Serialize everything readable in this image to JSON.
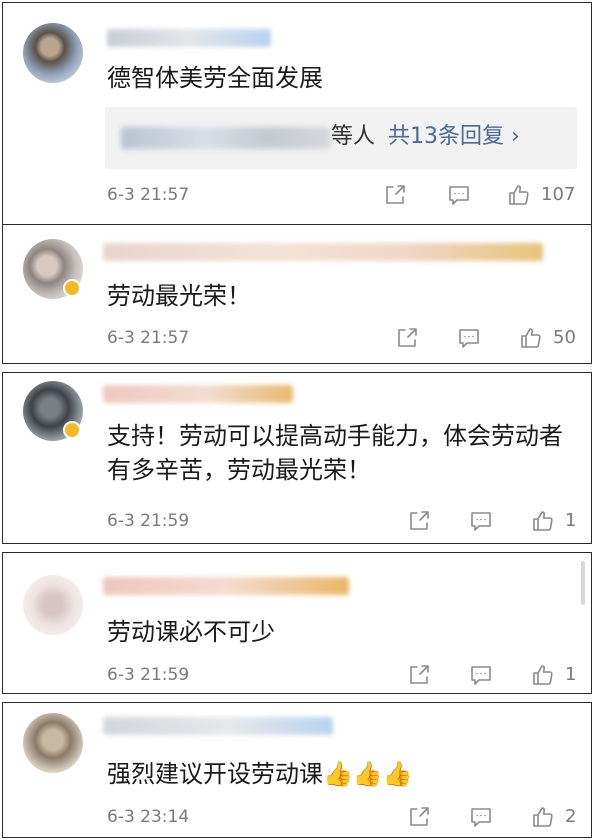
{
  "comments": [
    {
      "text": "德智体美劳全面发展",
      "reply_suffix": "等人",
      "reply_link": "共13条回复",
      "reply_chevron": "›",
      "time": "6-3 21:57",
      "likes": "107",
      "icons": {
        "share": "share-icon",
        "comment": "comment-icon",
        "like": "thumbs-up-icon"
      }
    },
    {
      "text": "劳动最光荣！",
      "time": "6-3 21:57",
      "likes": "50"
    },
    {
      "text": "支持！劳动可以提高动手能力，体会劳动者有多辛苦，劳动最光荣！",
      "time": "6-3 21:59",
      "likes": "1"
    },
    {
      "text": "劳动课必不可少",
      "time": "6-3 21:59",
      "likes": "1"
    },
    {
      "text": "强烈建议开设劳动课👍👍👍",
      "time": "6-3 23:14",
      "likes": "2"
    }
  ],
  "colors": {
    "link": "#4b6a93",
    "meta": "#7a7a7a",
    "text": "#1a1a1a",
    "badge": "#f5b923"
  }
}
